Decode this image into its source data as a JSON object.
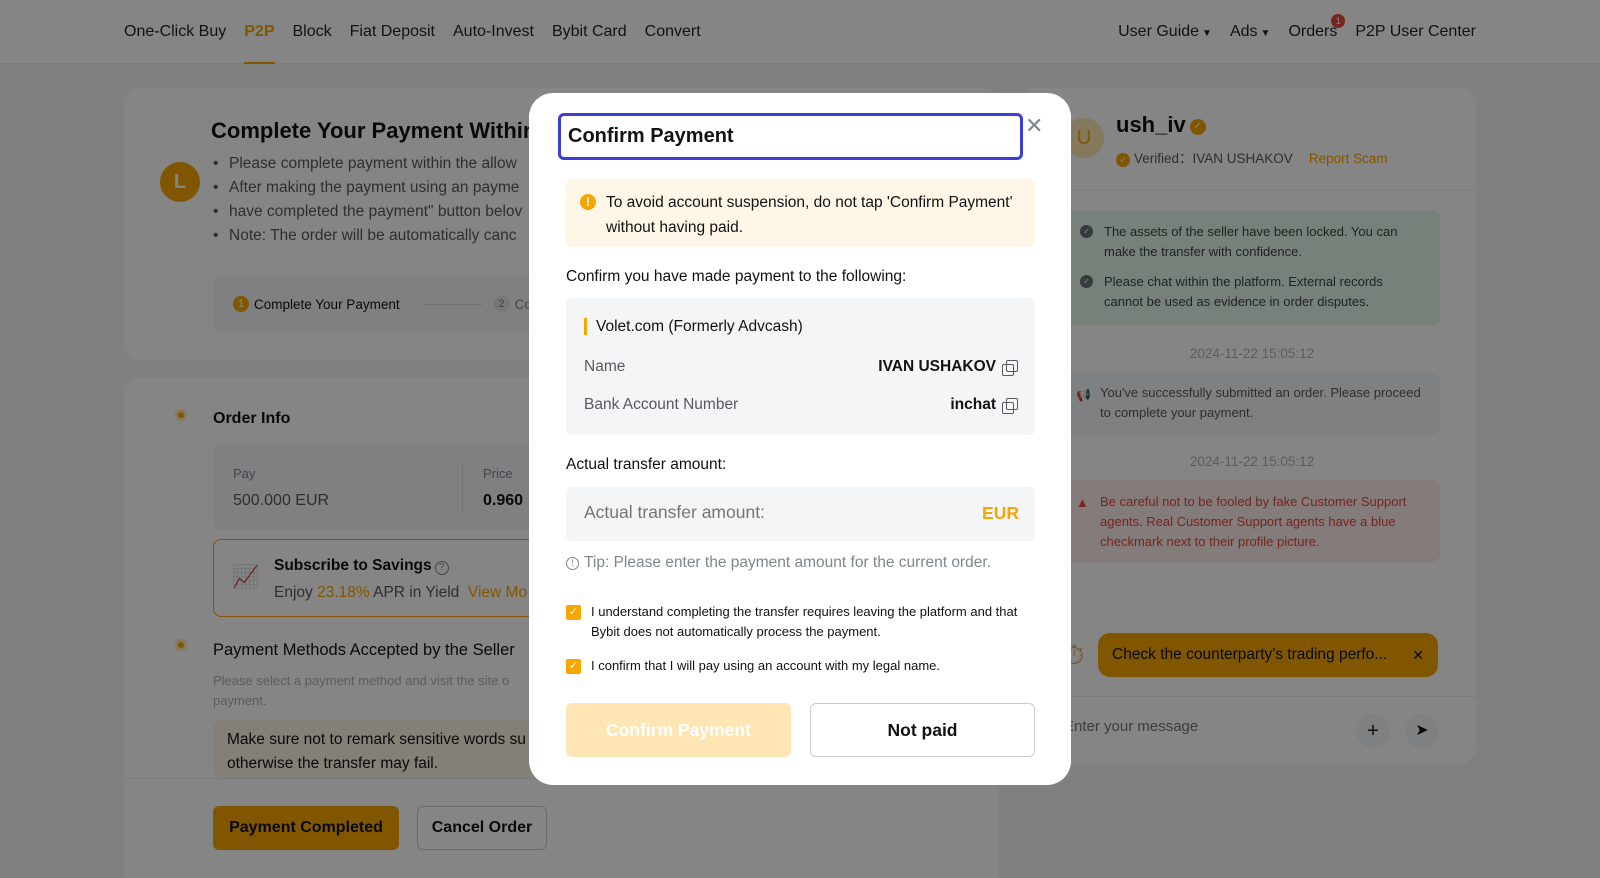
{
  "nav": {
    "left": [
      "One-Click Buy",
      "P2P",
      "Block",
      "Fiat Deposit",
      "Auto-Invest",
      "Bybit Card",
      "Convert"
    ],
    "active": "P2P",
    "user_guide": "User Guide",
    "ads": "Ads",
    "orders": "Orders",
    "orders_badge": "1",
    "p2p_user_center": "P2P User Center"
  },
  "payment": {
    "avatar_letter": "L",
    "title": "Complete Your Payment Within",
    "bullets": [
      "Please complete payment within the allow",
      "After making the payment using an payme",
      "have completed the payment\" button belov",
      "Note: The order will be automatically canc"
    ],
    "step1_num": "1",
    "step1": "Complete Your Payment",
    "step2_num": "2",
    "step2": "Co"
  },
  "order": {
    "section_title": "Order Info",
    "pay_label": "Pay",
    "pay_value": "500.000 EUR",
    "price_label": "Price",
    "price_value": "0.960"
  },
  "savings": {
    "title": "Subscribe to Savings",
    "text_prefix": "Enjoy ",
    "apr": "23.18%",
    "text_suffix": " APR in Yield",
    "link": "View Mo"
  },
  "payment_methods": {
    "title": "Payment Methods Accepted by the Seller",
    "subtitle": "Please select a payment method and visit the site o payment.",
    "remark": "Make sure not to remark sensitive words su otherwise the transfer may fail."
  },
  "footer": {
    "payment_completed": "Payment Completed",
    "cancel_order": "Cancel Order"
  },
  "chat": {
    "avatar_letter": "U",
    "name": "ush_iv",
    "verified": "Verified：IVAN USHAKOV",
    "report": "Report Scam",
    "notice1": "The assets of the seller have been locked. You can make the transfer with confidence.",
    "notice2": "Please chat within the platform. External records cannot be used as evidence in order disputes.",
    "ts1": "2024-11-22 15:05:12",
    "sys_msg": "You've successfully submitted an order. Please proceed to complete your payment.",
    "ts2": "2024-11-22 15:05:12",
    "warning": "Be careful not to be fooled by fake Customer Support agents. Real Customer Support agents have a blue checkmark next to their profile picture.",
    "pill": "Check the counterparty's trading perfo...",
    "input_placeholder": "Enter your message"
  },
  "modal": {
    "title": "Confirm Payment",
    "warning": "To avoid account suspension, do not tap 'Confirm Payment' without having paid.",
    "confirm_label": "Confirm you have made payment to the following:",
    "method": "Volet.com (Formerly Advcash)",
    "name_label": "Name",
    "name_value": "IVAN USHAKOV",
    "account_label": "Bank Account Number",
    "account_value": "inchat",
    "amount_label": "Actual transfer amount:",
    "amount_placeholder": "Actual transfer amount:",
    "currency": "EUR",
    "tip": "Tip: Please enter the payment amount for the current order.",
    "check1": "I understand completing the transfer requires leaving the platform and that Bybit does not automatically process the payment.",
    "check2": "I confirm that I will pay using an account with my legal name.",
    "confirm_button": "Confirm Payment",
    "not_paid_button": "Not paid"
  },
  "colors": {
    "accent": "#f7a600",
    "focus_ring": "#3b3fd8",
    "danger": "#e5473a"
  }
}
